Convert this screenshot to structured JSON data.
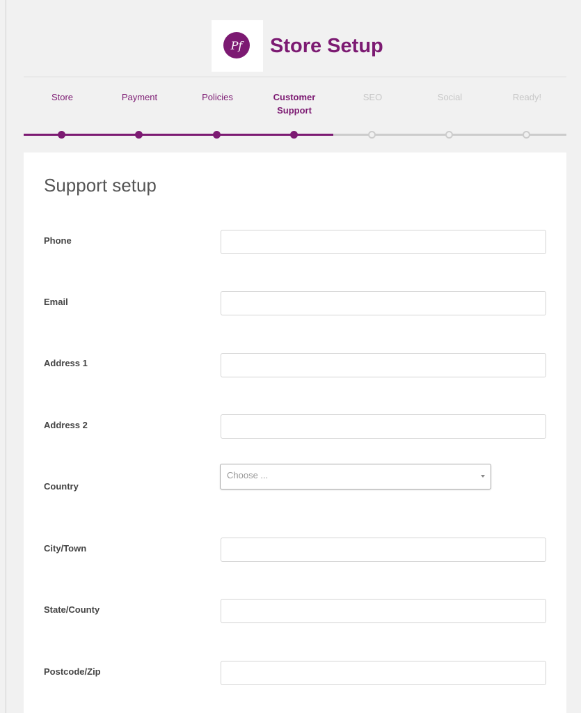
{
  "brand": {
    "logo_text": "Pf",
    "title": "Store Setup",
    "accent": "#7c1a72"
  },
  "steps": [
    {
      "label": "Store",
      "state": "done"
    },
    {
      "label": "Payment",
      "state": "done"
    },
    {
      "label": "Policies",
      "state": "done"
    },
    {
      "label": "Customer Support",
      "state": "current"
    },
    {
      "label": "SEO",
      "state": "pending"
    },
    {
      "label": "Social",
      "state": "pending"
    },
    {
      "label": "Ready!",
      "state": "pending"
    }
  ],
  "form": {
    "title": "Support setup",
    "fields": [
      {
        "label": "Phone",
        "value": ""
      },
      {
        "label": "Email",
        "value": ""
      },
      {
        "label": "Address 1",
        "value": ""
      },
      {
        "label": "Address 2",
        "value": ""
      },
      {
        "label": "Country",
        "value": "Choose ..."
      },
      {
        "label": "City/Town",
        "value": ""
      },
      {
        "label": "State/County",
        "value": ""
      },
      {
        "label": "Postcode/Zip",
        "value": ""
      }
    ]
  }
}
